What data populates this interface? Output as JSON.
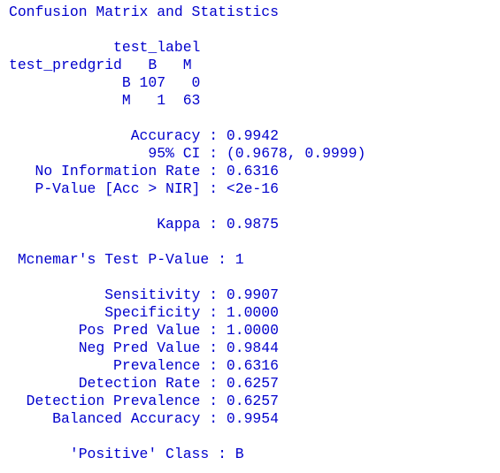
{
  "output": {
    "title": "Confusion Matrix and Statistics",
    "matrix": {
      "header": "            test_label",
      "columns": "test_predgrid   B   M",
      "row_b": "             B 107   0",
      "row_m": "             M   1  63"
    },
    "overall": {
      "accuracy": "              Accuracy : 0.9942",
      "ci": "                95% CI : (0.9678, 0.9999)",
      "nir": "   No Information Rate : 0.6316",
      "pvalue": "   P-Value [Acc > NIR] : <2e-16",
      "kappa": "                 Kappa : 0.9875",
      "mcnemar": " Mcnemar's Test P-Value : 1"
    },
    "by_class": {
      "sensitivity": "           Sensitivity : 0.9907",
      "specificity": "           Specificity : 1.0000",
      "ppv": "        Pos Pred Value : 1.0000",
      "npv": "        Neg Pred Value : 0.9844",
      "prevalence": "            Prevalence : 0.6316",
      "detection_rate": "        Detection Rate : 0.6257",
      "detection_prevalence": "  Detection Prevalence : 0.6257",
      "balanced_accuracy": "     Balanced Accuracy : 0.9954",
      "positive_class": "       'Positive' Class : B"
    }
  }
}
